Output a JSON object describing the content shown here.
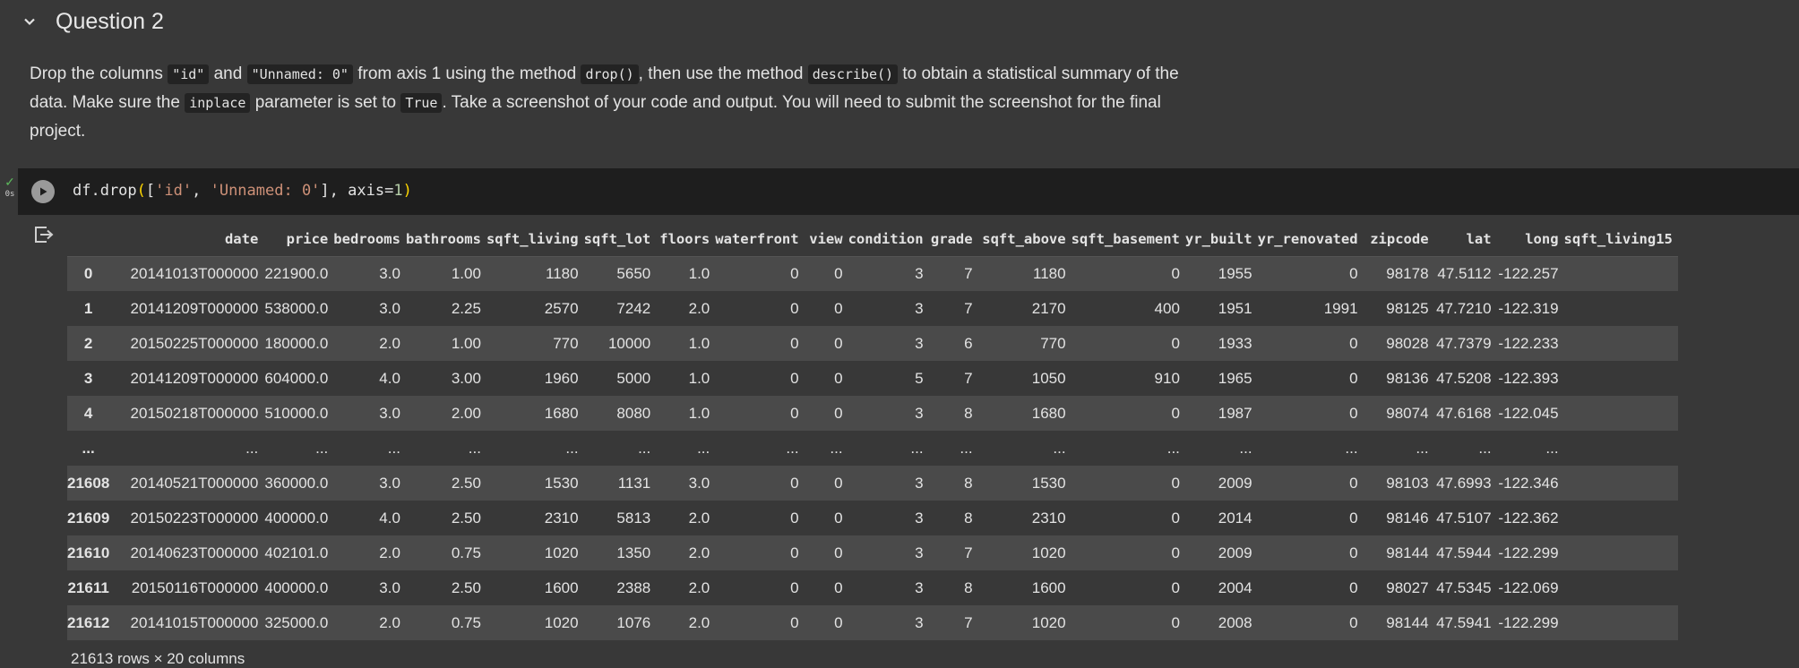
{
  "section": {
    "title": "Question 2"
  },
  "instructions": {
    "parts": [
      {
        "t": "Drop the columns "
      },
      {
        "c": "\"id\""
      },
      {
        "t": " and "
      },
      {
        "c": "\"Unnamed: 0\""
      },
      {
        "t": " from axis 1 using the method "
      },
      {
        "c": "drop()"
      },
      {
        "t": ", then use the method "
      },
      {
        "c": "describe()"
      },
      {
        "t": " to obtain a statistical summary of the data. Make sure the "
      },
      {
        "c": "inplace"
      },
      {
        "t": " parameter is set to "
      },
      {
        "c": "True"
      },
      {
        "t": ". Take a screenshot of your code and output. You will need to submit the screenshot for the final project."
      }
    ]
  },
  "cell": {
    "exec_time": "0s",
    "code_tokens": [
      {
        "t": "df.drop",
        "k": ""
      },
      {
        "t": "(",
        "k": "br"
      },
      {
        "t": "[",
        "k": ""
      },
      {
        "t": "'id'",
        "k": "str"
      },
      {
        "t": ", ",
        "k": ""
      },
      {
        "t": "'Unnamed: 0'",
        "k": "str"
      },
      {
        "t": "], axis=",
        "k": ""
      },
      {
        "t": "1",
        "k": "num"
      },
      {
        "t": ")",
        "k": "br"
      }
    ]
  },
  "dataframe": {
    "columns": [
      "",
      "date",
      "price",
      "bedrooms",
      "bathrooms",
      "sqft_living",
      "sqft_lot",
      "floors",
      "waterfront",
      "view",
      "condition",
      "grade",
      "sqft_above",
      "sqft_basement",
      "yr_built",
      "yr_renovated",
      "zipcode",
      "lat",
      "long",
      "sqft_living15"
    ],
    "rows": [
      [
        "0",
        "20141013T000000",
        "221900.0",
        "3.0",
        "1.00",
        "1180",
        "5650",
        "1.0",
        "0",
        "0",
        "3",
        "7",
        "1180",
        "0",
        "1955",
        "0",
        "98178",
        "47.5112",
        "-122.257",
        ""
      ],
      [
        "1",
        "20141209T000000",
        "538000.0",
        "3.0",
        "2.25",
        "2570",
        "7242",
        "2.0",
        "0",
        "0",
        "3",
        "7",
        "2170",
        "400",
        "1951",
        "1991",
        "98125",
        "47.7210",
        "-122.319",
        ""
      ],
      [
        "2",
        "20150225T000000",
        "180000.0",
        "2.0",
        "1.00",
        "770",
        "10000",
        "1.0",
        "0",
        "0",
        "3",
        "6",
        "770",
        "0",
        "1933",
        "0",
        "98028",
        "47.7379",
        "-122.233",
        ""
      ],
      [
        "3",
        "20141209T000000",
        "604000.0",
        "4.0",
        "3.00",
        "1960",
        "5000",
        "1.0",
        "0",
        "0",
        "5",
        "7",
        "1050",
        "910",
        "1965",
        "0",
        "98136",
        "47.5208",
        "-122.393",
        ""
      ],
      [
        "4",
        "20150218T000000",
        "510000.0",
        "3.0",
        "2.00",
        "1680",
        "8080",
        "1.0",
        "0",
        "0",
        "3",
        "8",
        "1680",
        "0",
        "1987",
        "0",
        "98074",
        "47.6168",
        "-122.045",
        ""
      ],
      [
        "...",
        "...",
        "...",
        "...",
        "...",
        "...",
        "...",
        "...",
        "...",
        "...",
        "...",
        "...",
        "...",
        "...",
        "...",
        "...",
        "...",
        "...",
        "...",
        ""
      ],
      [
        "21608",
        "20140521T000000",
        "360000.0",
        "3.0",
        "2.50",
        "1530",
        "1131",
        "3.0",
        "0",
        "0",
        "3",
        "8",
        "1530",
        "0",
        "2009",
        "0",
        "98103",
        "47.6993",
        "-122.346",
        ""
      ],
      [
        "21609",
        "20150223T000000",
        "400000.0",
        "4.0",
        "2.50",
        "2310",
        "5813",
        "2.0",
        "0",
        "0",
        "3",
        "8",
        "2310",
        "0",
        "2014",
        "0",
        "98146",
        "47.5107",
        "-122.362",
        ""
      ],
      [
        "21610",
        "20140623T000000",
        "402101.0",
        "2.0",
        "0.75",
        "1020",
        "1350",
        "2.0",
        "0",
        "0",
        "3",
        "7",
        "1020",
        "0",
        "2009",
        "0",
        "98144",
        "47.5944",
        "-122.299",
        ""
      ],
      [
        "21611",
        "20150116T000000",
        "400000.0",
        "3.0",
        "2.50",
        "1600",
        "2388",
        "2.0",
        "0",
        "0",
        "3",
        "8",
        "1600",
        "0",
        "2004",
        "0",
        "98027",
        "47.5345",
        "-122.069",
        ""
      ],
      [
        "21612",
        "20141015T000000",
        "325000.0",
        "2.0",
        "0.75",
        "1020",
        "1076",
        "2.0",
        "0",
        "0",
        "3",
        "7",
        "1020",
        "0",
        "2008",
        "0",
        "98144",
        "47.5941",
        "-122.299",
        ""
      ]
    ],
    "footer": "21613 rows × 20 columns"
  }
}
